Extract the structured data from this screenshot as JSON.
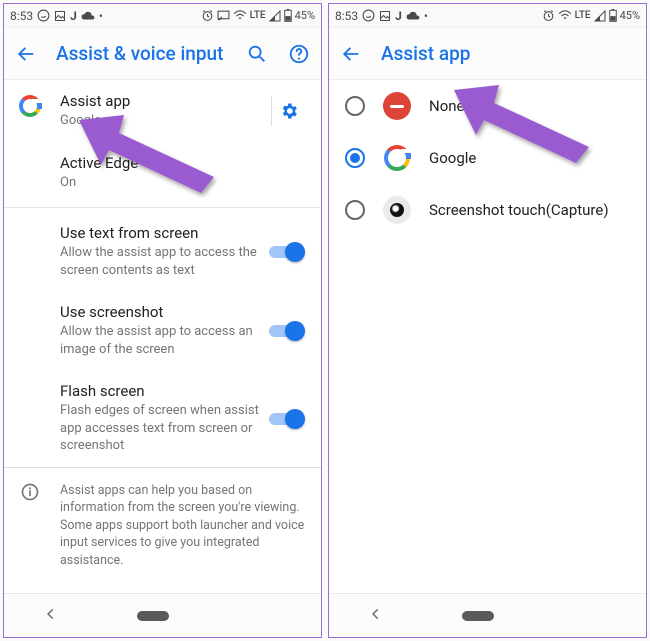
{
  "statusbar": {
    "time": "8:53",
    "net_label": "LTE",
    "battery_pct": "45%"
  },
  "left": {
    "title": "Assist & voice input",
    "assist": {
      "title": "Assist app",
      "value": "Google"
    },
    "edge": {
      "title": "Active Edge",
      "value": "On"
    },
    "items": [
      {
        "title": "Use text from screen",
        "desc": "Allow the assist app to access the screen contents as text"
      },
      {
        "title": "Use screenshot",
        "desc": "Allow the assist app to access an image of the screen"
      },
      {
        "title": "Flash screen",
        "desc": "Flash edges of screen when assist app accesses text from screen or screenshot"
      }
    ],
    "info": "Assist apps can help you based on information from the screen you're viewing. Some apps support both launcher and voice input services to give you integrated assistance."
  },
  "right": {
    "title": "Assist app",
    "options": [
      {
        "label": "None"
      },
      {
        "label": "Google"
      },
      {
        "label": "Screenshot touch(Capture)"
      }
    ]
  }
}
